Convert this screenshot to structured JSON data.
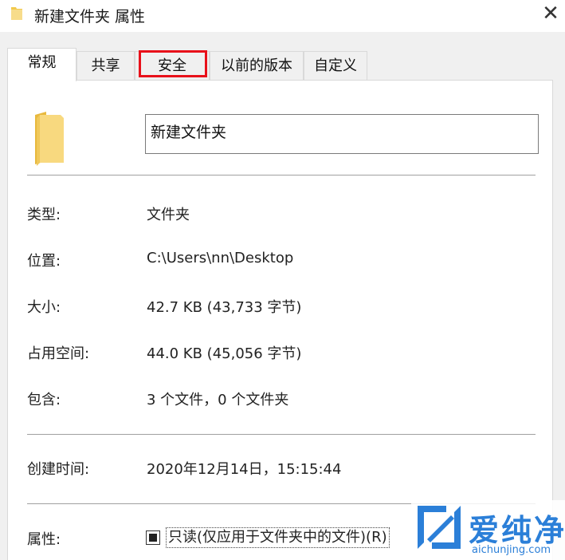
{
  "window": {
    "title": "新建文件夹 属性",
    "close_label": "✕"
  },
  "tabs": [
    {
      "label": "常规",
      "active": true
    },
    {
      "label": "共享",
      "active": false
    },
    {
      "label": "安全",
      "active": false,
      "highlighted": true
    },
    {
      "label": "以前的版本",
      "active": false
    },
    {
      "label": "自定义",
      "active": false
    }
  ],
  "general": {
    "folder_name": "新建文件夹",
    "rows": [
      {
        "label": "类型:",
        "value": "文件夹"
      },
      {
        "label": "位置:",
        "value": "C:\\Users\\nn\\Desktop"
      },
      {
        "label": "大小:",
        "value": "42.7 KB (43,733 字节)"
      },
      {
        "label": "占用空间:",
        "value": "44.0 KB (45,056 字节)"
      },
      {
        "label": "包含:",
        "value": "3 个文件，0 个文件夹"
      }
    ],
    "created_label": "创建时间:",
    "created_value": "2020年12月14日，15:15:44",
    "attributes_label": "属性:",
    "readonly_label": "只读(仅应用于文件夹中的文件)(R)"
  },
  "watermark": {
    "cn": "爱纯净",
    "en": "aichunjing.com"
  },
  "colors": {
    "highlight": "#e8101a",
    "folder": "#f5d67a",
    "watermark": "#2b7fd8",
    "dialog_bg": "#f0f0f0"
  }
}
